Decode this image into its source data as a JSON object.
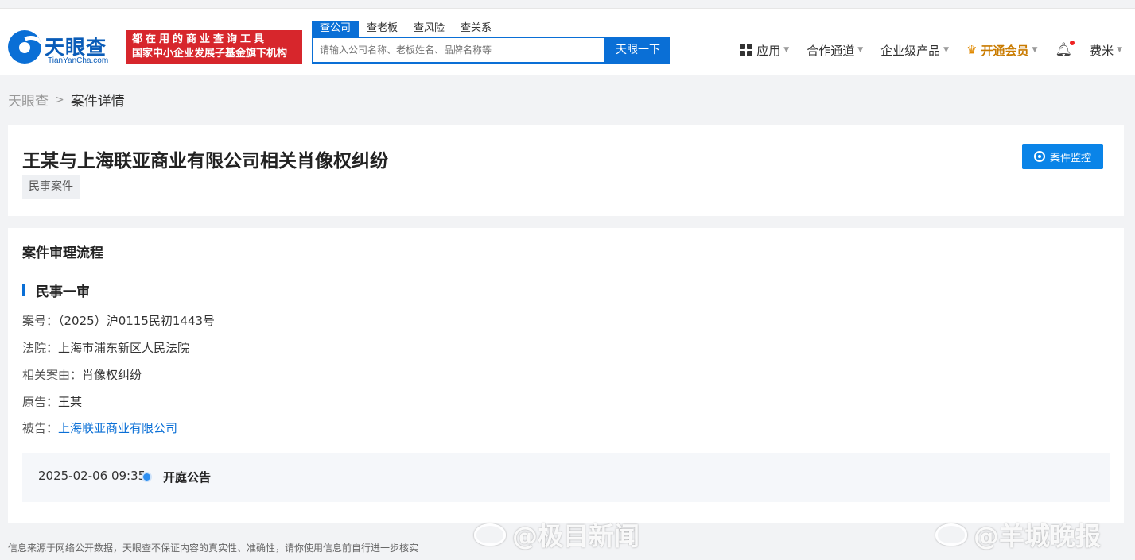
{
  "header": {
    "logo_cn": "天眼查",
    "logo_en": "TianYanCha.com",
    "slogan_line1": "都在用的商业查询工具",
    "slogan_line2": "国家中小企业发展子基金旗下机构",
    "search_tabs": [
      "查公司",
      "查老板",
      "查风险",
      "查关系"
    ],
    "search_placeholder": "请输入公司名称、老板姓名、品牌名称等",
    "search_button": "天眼一下",
    "nav": {
      "apps": "应用",
      "partner": "合作通道",
      "enterprise": "企业级产品",
      "vip": "开通会员",
      "user": "费米"
    }
  },
  "breadcrumb": {
    "home": "天眼查",
    "current": "案件详情"
  },
  "case": {
    "title": "王某与上海联亚商业有限公司相关肖像权纠纷",
    "tag": "民事案件",
    "monitor_button": "案件监控"
  },
  "process": {
    "section_title": "案件审理流程",
    "stage": "民事一审",
    "fields": [
      {
        "label": "案号：",
        "value": "（2025）沪0115民初1443号"
      },
      {
        "label": "法院：",
        "value": "上海市浦东新区人民法院"
      },
      {
        "label": "相关案由：",
        "value": "肖像权纠纷"
      },
      {
        "label": "原告：",
        "value": "王某"
      },
      {
        "label": "被告：",
        "value": "上海联亚商业有限公司"
      }
    ],
    "timeline": {
      "time": "2025-02-06 09:35",
      "event": "开庭公告"
    }
  },
  "footer": {
    "disclaimer": "信息来源于网络公开数据，天眼查不保证内容的真实性、准确性，请你使用信息前自行进一步核实"
  },
  "watermarks": [
    "@极目新闻",
    "@羊城晚报"
  ],
  "colors": {
    "brand_blue": "#0a6fd6",
    "slogan_red": "#d7262c",
    "vip_gold": "#c97b00"
  }
}
